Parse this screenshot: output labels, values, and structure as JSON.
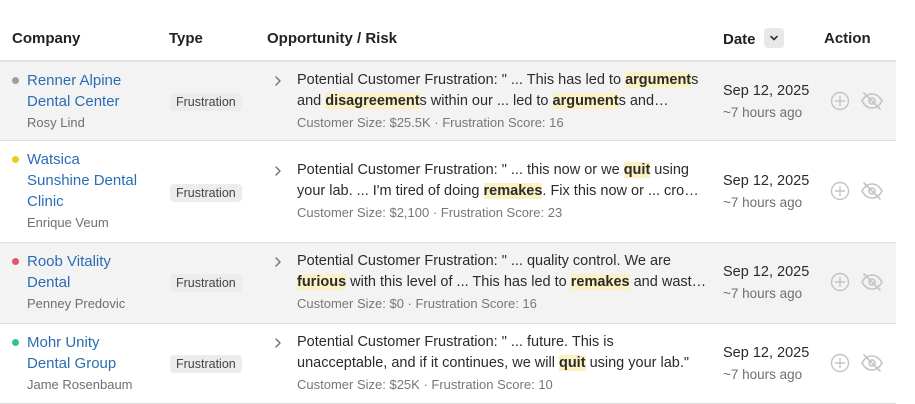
{
  "header": {
    "company": "Company",
    "type": "Type",
    "opportunity": "Opportunity / Risk",
    "date": "Date",
    "action": "Action"
  },
  "colors": {
    "link": "#2a6db4",
    "highlight": "#fbf1c4",
    "dot_gray": "#9e9e9e",
    "dot_yellow": "#e6cf1c",
    "dot_red": "#e5566a",
    "dot_green": "#33c28c"
  },
  "icons": [
    "chevron-down-icon",
    "chevron-right-icon",
    "add-circle-icon",
    "eye-slash-icon"
  ],
  "rows": [
    {
      "company_line1": "Renner Alpine",
      "company_line2": "Dental Center",
      "company_line3": "",
      "contact": "Rosy Lind",
      "dot_color": "gray",
      "type": "Frustration",
      "opp_line1": [
        {
          "t": "Potential Customer Frustration: \" ... This has led to "
        },
        {
          "t": "argument",
          "h": true
        },
        {
          "t": "s"
        }
      ],
      "opp_line2": [
        {
          "t": "and "
        },
        {
          "t": "disagreement",
          "h": true
        },
        {
          "t": "s within our ... led to "
        },
        {
          "t": "argument",
          "h": true
        },
        {
          "t": "s and…"
        }
      ],
      "meta": "Customer Size: $25.5K · Frustration Score: 16",
      "date": "Sep 12, 2025",
      "ago": "~7 hours ago"
    },
    {
      "company_line1": "Watsica",
      "company_line2": "Sunshine Dental",
      "company_line3": "Clinic",
      "contact": "Enrique Veum",
      "dot_color": "yellow",
      "type": "Frustration",
      "opp_line1": [
        {
          "t": "Potential Customer Frustration: \" ... this now or we "
        },
        {
          "t": "quit",
          "h": true
        },
        {
          "t": " using"
        }
      ],
      "opp_line2": [
        {
          "t": "your lab. ... I'm tired of doing "
        },
        {
          "t": "remakes",
          "h": true
        },
        {
          "t": ". Fix this now or ... crow…"
        }
      ],
      "meta": "Customer Size: $2,100 · Frustration Score: 23",
      "date": "Sep 12, 2025",
      "ago": "~7 hours ago"
    },
    {
      "company_line1": "Roob Vitality",
      "company_line2": "Dental",
      "company_line3": "",
      "contact": "Penney Predovic",
      "dot_color": "red",
      "type": "Frustration",
      "opp_line1": [
        {
          "t": "Potential Customer Frustration: \" ... quality control. We are"
        }
      ],
      "opp_line2": [
        {
          "t": "furious",
          "h": true
        },
        {
          "t": " with this level of ... This has led to "
        },
        {
          "t": "remakes",
          "h": true
        },
        {
          "t": " and waste…"
        }
      ],
      "meta": "Customer Size: $0 · Frustration Score: 16",
      "date": "Sep 12, 2025",
      "ago": "~7 hours ago"
    },
    {
      "company_line1": "Mohr Unity",
      "company_line2": "Dental Group",
      "company_line3": "",
      "contact": "Jame Rosenbaum",
      "dot_color": "green",
      "type": "Frustration",
      "opp_line1": [
        {
          "t": "Potential Customer Frustration: \" ... future. This is"
        }
      ],
      "opp_line2": [
        {
          "t": "unacceptable, and if it continues, we will "
        },
        {
          "t": "quit",
          "h": true
        },
        {
          "t": " using your lab.\""
        }
      ],
      "meta": "Customer Size: $25K · Frustration Score: 10",
      "date": "Sep 12, 2025",
      "ago": "~7 hours ago"
    }
  ]
}
